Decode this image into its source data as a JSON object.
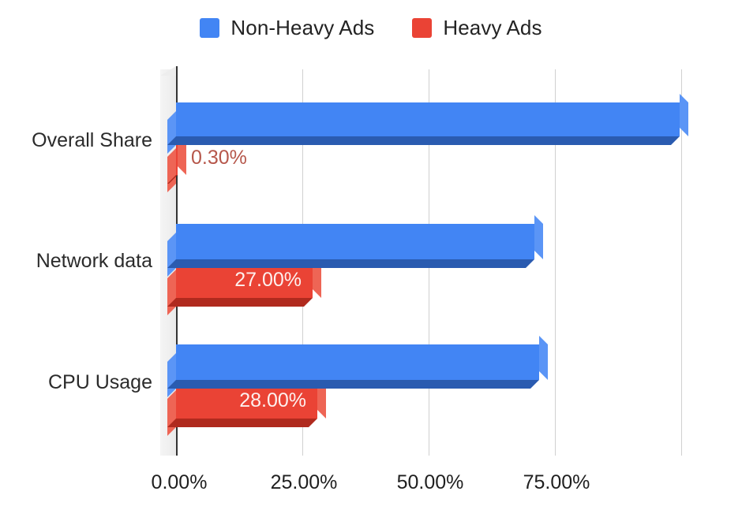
{
  "legend": {
    "position": "top-center",
    "items": [
      {
        "label": "Non-Heavy Ads",
        "color": "#4285F4",
        "key": "non_heavy"
      },
      {
        "label": "Heavy Ads",
        "color": "#EA4335",
        "key": "heavy"
      }
    ]
  },
  "axis": {
    "x_ticks": [
      "0.00%",
      "25.00%",
      "50.00%",
      "75.00%"
    ],
    "x_tick_values": [
      0,
      25,
      50,
      75
    ],
    "y_categories": [
      "Overall Share",
      "Network data",
      "CPU Usage"
    ]
  },
  "labels": {
    "overall_heavy": "0.30%",
    "network_heavy": "27.00%",
    "cpu_heavy": "28.00%"
  },
  "colors": {
    "blue_front": "#4285F4",
    "blue_side": "#5B95F6",
    "blue_bottom": "#2A5BB0",
    "red_front": "#EA4335",
    "red_side": "#EE6555",
    "red_bottom": "#B02A1E",
    "gridline": "#d0d0d0",
    "axis": "#333333",
    "label_inside": "#fdf0ee",
    "label_outside": "#b6574b"
  },
  "chart_data": {
    "type": "bar",
    "orientation": "horizontal",
    "style": "3d",
    "title": "",
    "xlabel": "",
    "ylabel": "",
    "categories": [
      "Overall Share",
      "Network data",
      "CPU Usage"
    ],
    "series": [
      {
        "name": "Non-Heavy Ads",
        "color": "#4285F4",
        "values": [
          99.7,
          71.0,
          72.0
        ],
        "labels": [
          "",
          "",
          ""
        ]
      },
      {
        "name": "Heavy Ads",
        "color": "#EA4335",
        "values": [
          0.3,
          27.0,
          28.0
        ],
        "labels": [
          "0.30%",
          "27.00%",
          "28.00%"
        ]
      }
    ],
    "xlim": [
      0,
      100
    ],
    "xticks": [
      0,
      25,
      50,
      75
    ],
    "xticklabels": [
      "0.00%",
      "25.00%",
      "50.00%",
      "75.00%"
    ],
    "grid": "vertical",
    "legend_position": "top-center",
    "value_format": "percent-2dp"
  }
}
